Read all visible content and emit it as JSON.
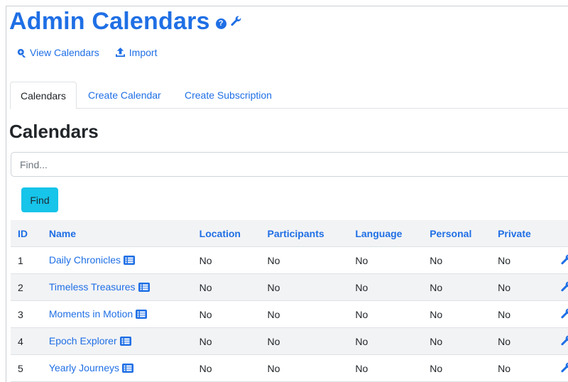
{
  "header": {
    "title": "Admin Calendars",
    "help_icon": "question-circle-icon",
    "settings_icon": "wrench-icon"
  },
  "actions": {
    "view_calendars": "View Calendars",
    "import": "Import"
  },
  "tabs": [
    {
      "label": "Calendars",
      "active": true
    },
    {
      "label": "Create Calendar",
      "active": false
    },
    {
      "label": "Create Subscription",
      "active": false
    }
  ],
  "section": {
    "title": "Calendars"
  },
  "search": {
    "placeholder": "Find...",
    "value": "",
    "button_label": "Find"
  },
  "table": {
    "headers": [
      "ID",
      "Name",
      "Location",
      "Participants",
      "Language",
      "Personal",
      "Private"
    ],
    "rows": [
      {
        "id": "1",
        "name": "Daily Chronicles",
        "location": "No",
        "participants": "No",
        "language": "No",
        "personal": "No",
        "private": "No"
      },
      {
        "id": "2",
        "name": "Timeless Treasures",
        "location": "No",
        "participants": "No",
        "language": "No",
        "personal": "No",
        "private": "No"
      },
      {
        "id": "3",
        "name": "Moments in Motion",
        "location": "No",
        "participants": "No",
        "language": "No",
        "personal": "No",
        "private": "No"
      },
      {
        "id": "4",
        "name": "Epoch Explorer",
        "location": "No",
        "participants": "No",
        "language": "No",
        "personal": "No",
        "private": "No"
      },
      {
        "id": "5",
        "name": "Yearly Journeys",
        "location": "No",
        "participants": "No",
        "language": "No",
        "personal": "No",
        "private": "No"
      }
    ]
  },
  "colors": {
    "link": "#1f6fe5",
    "find_button": "#17c4ea",
    "stripe": "#f2f3f5"
  }
}
